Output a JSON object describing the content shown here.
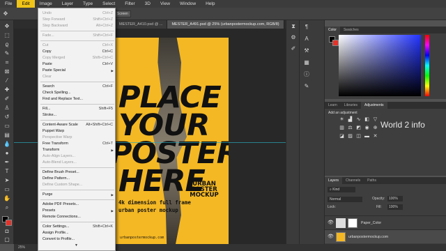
{
  "menubar": {
    "items": [
      "File",
      "Edit",
      "Image",
      "Layer",
      "Type",
      "Select",
      "Filter",
      "3D",
      "View",
      "Window",
      "Help"
    ],
    "active": "Edit"
  },
  "options": {
    "button1": "Screen"
  },
  "tabs": [
    {
      "label": "MESTER_A410.psd @ ..."
    },
    {
      "label": "MESTER_A491.psd @ 25% (urbanpostermockup.com, RGB/8)"
    }
  ],
  "edit_menu": {
    "items": [
      {
        "label": "Undo",
        "shortcut": "Ctrl+Z",
        "disabled": true
      },
      {
        "label": "Step Forward",
        "shortcut": "Shift+Ctrl+Z",
        "disabled": true
      },
      {
        "label": "Step Backward",
        "shortcut": "Alt+Ctrl+Z",
        "disabled": true
      },
      {
        "label": "Fade...",
        "shortcut": "Shift+Ctrl+F",
        "disabled": true
      },
      {
        "label": "Cut",
        "shortcut": "Ctrl+X",
        "disabled": true
      },
      {
        "label": "Copy",
        "shortcut": "Ctrl+C",
        "disabled": false
      },
      {
        "label": "Copy Merged",
        "shortcut": "Shift+Ctrl+C",
        "disabled": true
      },
      {
        "label": "Paste",
        "shortcut": "Ctrl+V",
        "disabled": false
      },
      {
        "label": "Paste Special",
        "shortcut": "",
        "disabled": false,
        "submenu": true
      },
      {
        "label": "Clear",
        "shortcut": "",
        "disabled": true
      },
      {
        "label": "Search",
        "shortcut": "Ctrl+F",
        "disabled": false
      },
      {
        "label": "Check Spelling...",
        "shortcut": "",
        "disabled": false
      },
      {
        "label": "Find and Replace Text...",
        "shortcut": "",
        "disabled": false
      },
      {
        "label": "Fill...",
        "shortcut": "Shift+F5",
        "disabled": false
      },
      {
        "label": "Stroke...",
        "shortcut": "",
        "disabled": false
      },
      {
        "label": "Content-Aware Scale",
        "shortcut": "Alt+Shift+Ctrl+C",
        "disabled": false
      },
      {
        "label": "Puppet Warp",
        "shortcut": "",
        "disabled": false
      },
      {
        "label": "Perspective Warp",
        "shortcut": "",
        "disabled": true
      },
      {
        "label": "Free Transform",
        "shortcut": "Ctrl+T",
        "disabled": false
      },
      {
        "label": "Transform",
        "shortcut": "",
        "disabled": false,
        "submenu": true
      },
      {
        "label": "Auto-Align Layers...",
        "shortcut": "",
        "disabled": true
      },
      {
        "label": "Auto-Blend Layers...",
        "shortcut": "",
        "disabled": true
      },
      {
        "label": "Define Brush Preset...",
        "shortcut": "",
        "disabled": false
      },
      {
        "label": "Define Pattern...",
        "shortcut": "",
        "disabled": false
      },
      {
        "label": "Define Custom Shape...",
        "shortcut": "",
        "disabled": true
      },
      {
        "label": "Purge",
        "shortcut": "",
        "disabled": false,
        "submenu": true
      },
      {
        "label": "Adobe PDF Presets...",
        "shortcut": "",
        "disabled": false
      },
      {
        "label": "Presets",
        "shortcut": "",
        "disabled": false,
        "submenu": true
      },
      {
        "label": "Remote Connections...",
        "shortcut": "",
        "disabled": false
      },
      {
        "label": "Color Settings...",
        "shortcut": "Shift+Ctrl+K",
        "disabled": false
      },
      {
        "label": "Assign Profile...",
        "shortcut": "",
        "disabled": false
      },
      {
        "label": "Convert to Profile...",
        "shortcut": "",
        "disabled": false
      }
    ]
  },
  "poster": {
    "headline": [
      "PLACE",
      "YOUR",
      "POSTER",
      "HERE"
    ],
    "sub1": "4k dimension full frame",
    "sub2": "urban poster mockup",
    "logo": [
      "URBAN",
      "POSTER",
      "MOCKUP"
    ],
    "url": "urbanpostermockup.com"
  },
  "color_panel": {
    "tabs": [
      "Color",
      "Swatches"
    ]
  },
  "adjust_panel": {
    "tabs": [
      "Learn",
      "Libraries",
      "Adjustments"
    ],
    "hint": "Add an adjustment"
  },
  "layers_panel": {
    "tabs": [
      "Layers",
      "Channels",
      "Paths"
    ],
    "filter": "Kind",
    "blend": "Normal",
    "opacity_label": "Opacity:",
    "opacity": "100%",
    "lock_label": "Lock:",
    "fill_label": "Fill:",
    "fill": "100%",
    "layers": [
      {
        "name": "Paper_Color"
      },
      {
        "name": "urbanpostermockup.com"
      }
    ]
  },
  "watermark": "World 2 info",
  "status": {
    "zoom": "25%"
  },
  "colors": {
    "accent": "#f0c419",
    "poster": "#f4b824",
    "fg": "#000000",
    "bg": "#e5332a"
  }
}
